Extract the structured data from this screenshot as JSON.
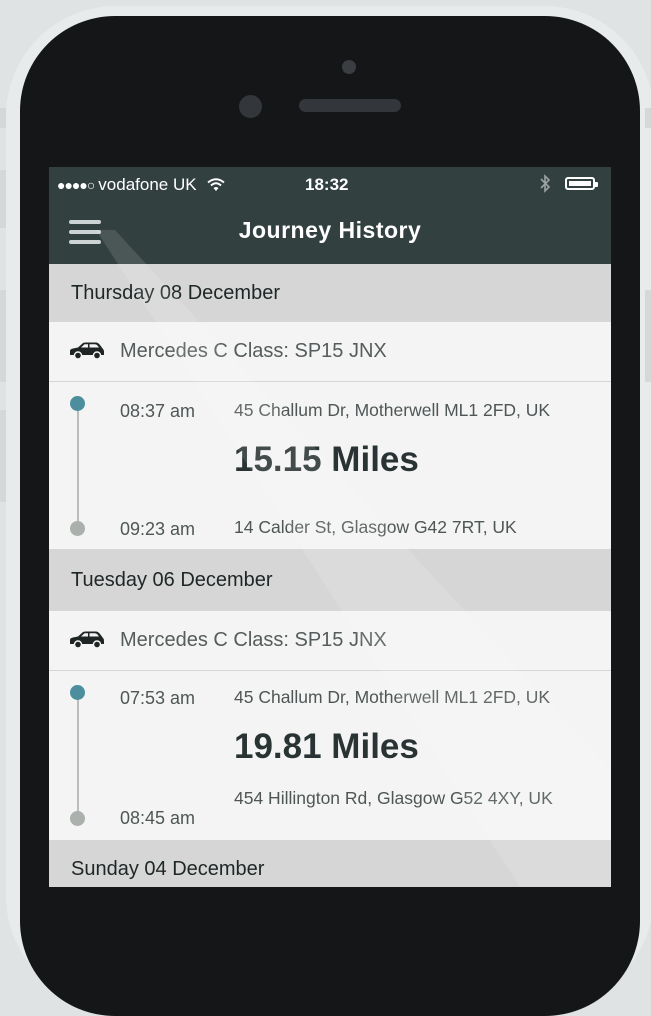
{
  "status_bar": {
    "signal": "●●●●○",
    "carrier": "vodafone UK",
    "time": "18:32"
  },
  "header": {
    "title": "Journey History"
  },
  "days": [
    {
      "date": "Thursday 08 December",
      "vehicle": "Mercedes C Class: SP15 JNX",
      "start_time": "08:37 am",
      "start_address": "45 Challum Dr, Motherwell ML1 2FD, UK",
      "distance": "15.15 Miles",
      "end_time": "09:23 am",
      "end_address": "14 Calder St, Glasgow G42 7RT, UK"
    },
    {
      "date": "Tuesday 06 December",
      "vehicle": "Mercedes C Class: SP15 JNX",
      "start_time": "07:53 am",
      "start_address": "45 Challum Dr, Motherwell ML1 2FD, UK",
      "distance": "19.81 Miles",
      "end_time": "08:45 am",
      "end_address": "454 Hillington Rd, Glasgow G52 4XY, UK"
    },
    {
      "date": "Sunday 04 December"
    }
  ],
  "icons": {
    "menu": "hamburger-icon",
    "vehicle": "car-icon",
    "wifi": "wifi-icon",
    "bluetooth": "bluetooth-icon",
    "battery": "battery-icon"
  },
  "colors": {
    "header_bg": "#334040",
    "start_dot": "#4d8e9e",
    "end_dot": "#aab0ab",
    "day_header_bg": "#d6d6d6"
  }
}
